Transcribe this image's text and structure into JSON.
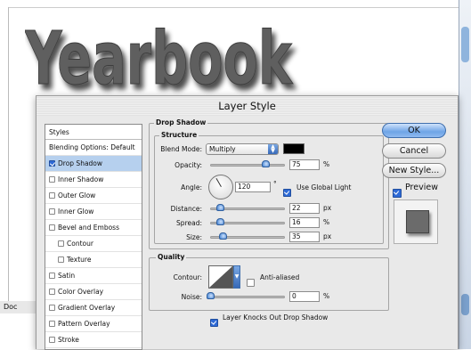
{
  "document": {
    "headline": "Yearbook",
    "status_label": "Doc"
  },
  "dialog": {
    "title": "Layer Style"
  },
  "styles_list": {
    "header": "Styles",
    "items": [
      {
        "label": "Blending Options: Default",
        "checkbox": false,
        "checked": false,
        "selected": false,
        "indent": false
      },
      {
        "label": "Drop Shadow",
        "checkbox": true,
        "checked": true,
        "selected": true,
        "indent": false
      },
      {
        "label": "Inner Shadow",
        "checkbox": true,
        "checked": false,
        "selected": false,
        "indent": false
      },
      {
        "label": "Outer Glow",
        "checkbox": true,
        "checked": false,
        "selected": false,
        "indent": false
      },
      {
        "label": "Inner Glow",
        "checkbox": true,
        "checked": false,
        "selected": false,
        "indent": false
      },
      {
        "label": "Bevel and Emboss",
        "checkbox": true,
        "checked": false,
        "selected": false,
        "indent": false
      },
      {
        "label": "Contour",
        "checkbox": true,
        "checked": false,
        "selected": false,
        "indent": true
      },
      {
        "label": "Texture",
        "checkbox": true,
        "checked": false,
        "selected": false,
        "indent": true
      },
      {
        "label": "Satin",
        "checkbox": true,
        "checked": false,
        "selected": false,
        "indent": false
      },
      {
        "label": "Color Overlay",
        "checkbox": true,
        "checked": false,
        "selected": false,
        "indent": false
      },
      {
        "label": "Gradient Overlay",
        "checkbox": true,
        "checked": false,
        "selected": false,
        "indent": false
      },
      {
        "label": "Pattern Overlay",
        "checkbox": true,
        "checked": false,
        "selected": false,
        "indent": false
      },
      {
        "label": "Stroke",
        "checkbox": true,
        "checked": false,
        "selected": false,
        "indent": false
      }
    ]
  },
  "drop_shadow": {
    "section_title": "Drop Shadow",
    "structure_title": "Structure",
    "blend_mode_label": "Blend Mode:",
    "blend_mode_value": "Multiply",
    "shadow_color": "#000000",
    "opacity_label": "Opacity:",
    "opacity_value": "75",
    "opacity_unit": "%",
    "opacity_level": 0.75,
    "angle_label": "Angle:",
    "angle_value": "120",
    "angle_unit": "°",
    "use_global_light_label": "Use Global Light",
    "use_global_light_checked": true,
    "distance_label": "Distance:",
    "distance_value": "22",
    "distance_unit": "px",
    "spread_label": "Spread:",
    "spread_value": "16",
    "spread_unit": "%",
    "size_label": "Size:",
    "size_value": "35",
    "size_unit": "px"
  },
  "quality": {
    "title": "Quality",
    "contour_label": "Contour:",
    "anti_aliased_label": "Anti-aliased",
    "anti_aliased_checked": false,
    "noise_label": "Noise:",
    "noise_value": "0",
    "noise_unit": "%",
    "knockout_label": "Layer Knocks Out Drop Shadow",
    "knockout_checked": true
  },
  "buttons": {
    "ok": "OK",
    "cancel": "Cancel",
    "new_style": "New Style...",
    "preview_label": "Preview",
    "preview_checked": true
  },
  "colors": {
    "accent": "#2e6ad6",
    "selection": "#b6d0ee",
    "dialog_bg": "#e9e9e9"
  }
}
